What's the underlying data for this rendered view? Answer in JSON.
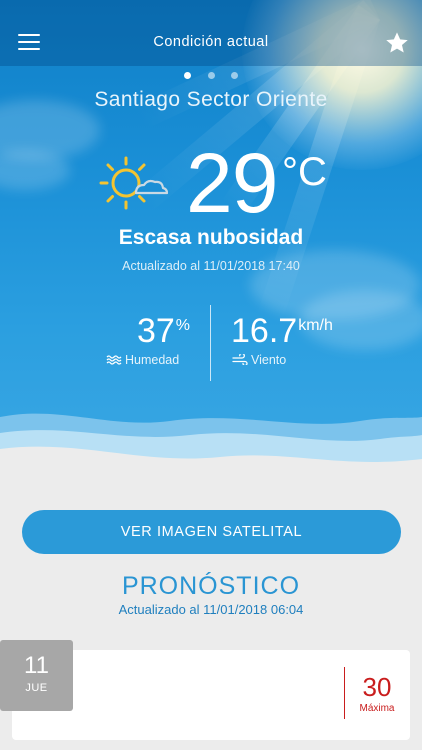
{
  "header": {
    "title": "Condición actual",
    "menu_icon": "menu-icon",
    "favorite_icon": "star-icon"
  },
  "pager": {
    "count": 3,
    "active": 1
  },
  "current": {
    "location": "Santiago Sector Oriente",
    "temperature": "29",
    "unit": "°C",
    "condition": "Escasa nubosidad",
    "updated": "Actualizado al 11/01/2018 17:40",
    "weather_icon": "sun-cloud-icon",
    "humidity": {
      "value": "37",
      "unit": "%",
      "label": "Humedad",
      "icon": "humidity-waves-icon"
    },
    "wind": {
      "value": "16.7",
      "unit": "km/h",
      "label": "Viento",
      "icon": "wind-icon"
    }
  },
  "satellite_button": "VER IMAGEN SATELITAL",
  "forecast": {
    "title": "PRONÓSTICO",
    "updated": "Actualizado al 11/01/2018 06:04",
    "days": [
      {
        "day_num": "11",
        "day_name": "JUE",
        "max_value": "30",
        "max_label": "Máxima"
      }
    ]
  },
  "colors": {
    "sky": "#1a8fd6",
    "accent": "#2b9ad8",
    "forecast_title": "#2a95d3",
    "max_temp": "#c91d1d",
    "badge": "#a7a7a7"
  }
}
